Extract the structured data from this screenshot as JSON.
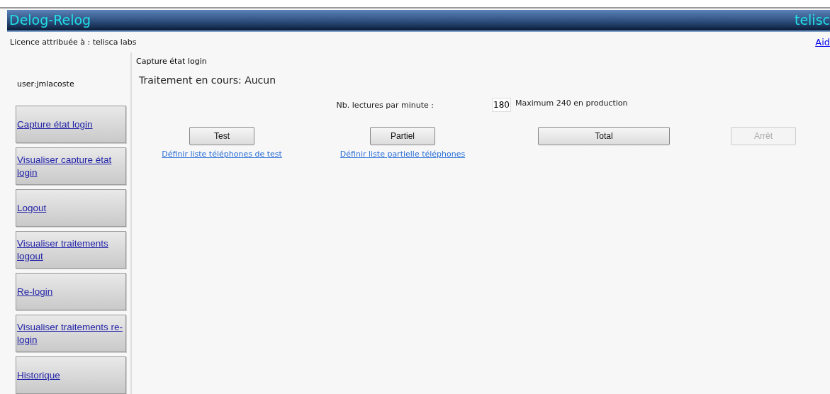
{
  "header": {
    "title": "Delog-Relog",
    "brand": "telisc"
  },
  "licence": "Licence attribuée à : telisca labs",
  "help_link": "Aid",
  "sidebar": {
    "user": "user:jmlacoste",
    "items": [
      {
        "label": "Capture état login"
      },
      {
        "label": "Visualiser capture état login"
      },
      {
        "label": "Logout"
      },
      {
        "label": "Visualiser traitements logout"
      },
      {
        "label": "Re-login"
      },
      {
        "label": "Visualiser traitements re-login"
      },
      {
        "label": "Historique"
      }
    ]
  },
  "content": {
    "breadcrumb": "Capture état login",
    "status": "Traitement en cours: Aucun",
    "rate": {
      "label": "Nb. lectures par minute :",
      "value": "180",
      "hint": "Maximum 240 en production"
    },
    "actions": [
      {
        "label": "Test",
        "disabled": false,
        "link": "Définir liste téléphones de test"
      },
      {
        "label": "Partiel",
        "disabled": false,
        "link": "Définir liste partielle téléphones"
      },
      {
        "label": "Total",
        "disabled": false,
        "wide": true
      },
      {
        "label": "Arrêt",
        "disabled": true
      }
    ]
  }
}
